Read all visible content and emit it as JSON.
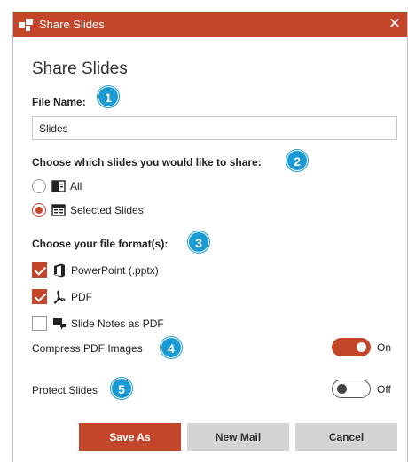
{
  "window": {
    "title": "Share Slides",
    "close_glyph": "✕"
  },
  "heading": "Share Slides",
  "file_name": {
    "label": "File Name:",
    "value": "Slides",
    "badge": "1"
  },
  "slides_choice": {
    "label": "Choose which slides you would like to share:",
    "badge": "2",
    "options": [
      {
        "label": "All",
        "icon": "presentation-icon",
        "selected": false
      },
      {
        "label": "Selected Slides",
        "icon": "slides-list-icon",
        "selected": true
      }
    ]
  },
  "formats": {
    "label": "Choose your file format(s):",
    "badge": "3",
    "options": [
      {
        "label": "PowerPoint (.pptx)",
        "icon": "office-icon",
        "checked": true
      },
      {
        "label": "PDF",
        "icon": "pdf-icon",
        "checked": true
      },
      {
        "label": "Slide Notes as PDF",
        "icon": "notes-icon",
        "checked": false
      }
    ]
  },
  "compress": {
    "label": "Compress PDF Images",
    "badge": "4",
    "state": "On"
  },
  "protect": {
    "label": "Protect Slides",
    "badge": "5",
    "state": "Off"
  },
  "buttons": {
    "save_as": "Save As",
    "new_mail": "New Mail",
    "cancel": "Cancel"
  },
  "colors": {
    "accent": "#c4462a",
    "badge": "#1b9bd6",
    "secondary_button": "#d4d4d4"
  }
}
